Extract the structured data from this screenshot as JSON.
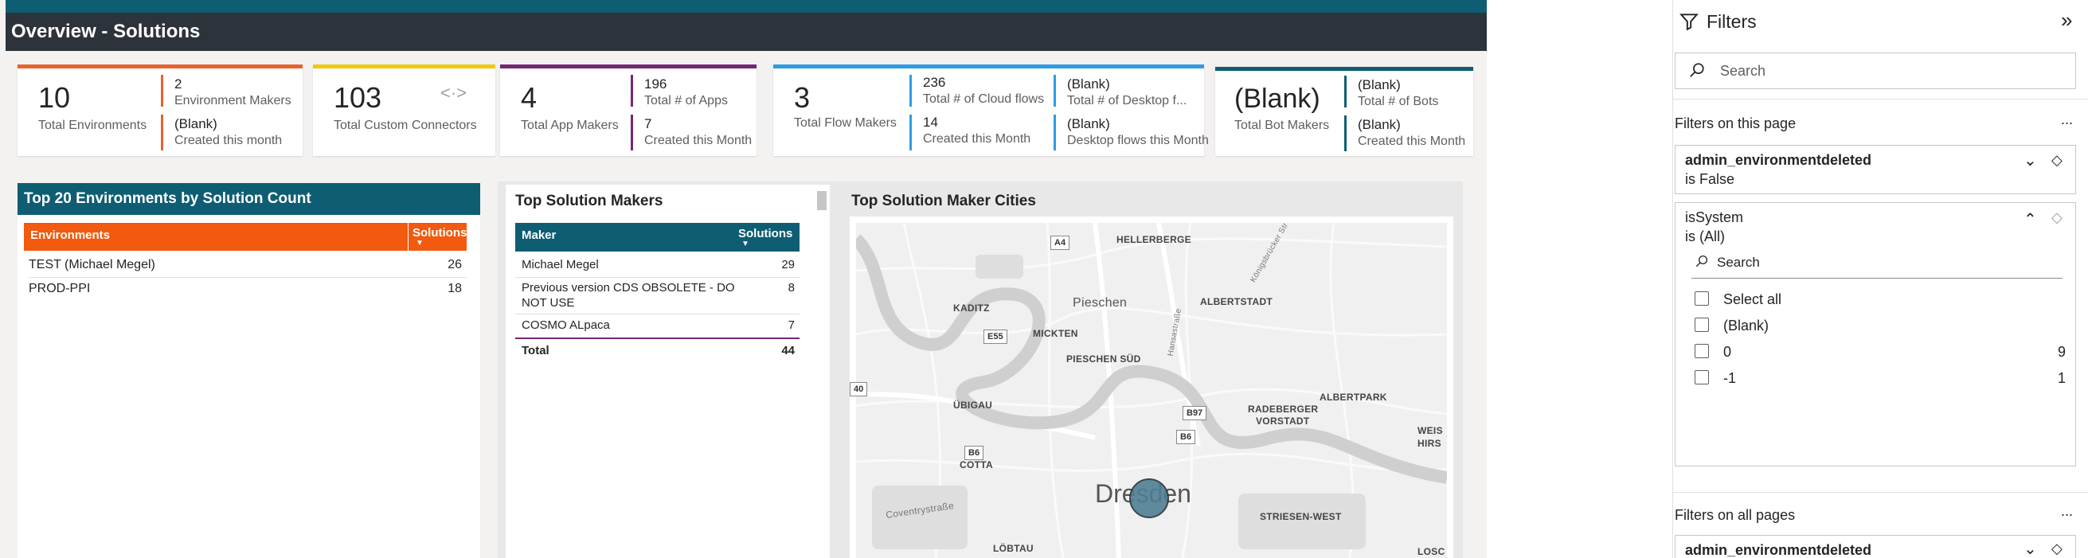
{
  "header": {
    "title": "Overview - Solutions"
  },
  "kpis": {
    "environments": {
      "value": "10",
      "label": "Total Environments",
      "makers_value": "2",
      "makers_label": "Environment Makers",
      "month_value": "(Blank)",
      "month_label": "Created this month",
      "color": "#e8622c"
    },
    "connectors": {
      "value": "103",
      "label": "Total Custom Connectors",
      "color": "#f2c80f"
    },
    "apps": {
      "value": "4",
      "label": "Total App Makers",
      "total_value": "196",
      "total_label": "Total # of Apps",
      "month_value": "7",
      "month_label": "Created this Month",
      "color": "#742774"
    },
    "flows": {
      "value": "3",
      "label": "Total Flow Makers",
      "cloud_value": "236",
      "cloud_label": "Total # of Cloud flows",
      "cloud_month_value": "14",
      "cloud_month_label": "Created this Month",
      "desktop_value": "(Blank)",
      "desktop_label": "Total # of Desktop f...",
      "desktop_month_value": "(Blank)",
      "desktop_month_label": "Desktop flows this Month",
      "color": "#2e9ce6"
    },
    "bots": {
      "value": "(Blank)",
      "label": "Total Bot Makers",
      "total_value": "(Blank)",
      "total_label": "Total # of Bots",
      "month_value": "(Blank)",
      "month_label": "Created this Month",
      "color": "#0e5d73"
    }
  },
  "env_table": {
    "title": "Top 20 Environments by Solution Count",
    "col_env": "Environments",
    "col_sol": "Solutions",
    "rows": [
      {
        "name": "TEST (Michael Megel)",
        "value": "26"
      },
      {
        "name": "PROD-PPI",
        "value": "18"
      }
    ]
  },
  "makers_table": {
    "title": "Top Solution Makers",
    "col_maker": "Maker",
    "col_sol": "Solutions",
    "rows": [
      {
        "name": "Michael Megel",
        "value": "29"
      },
      {
        "name": "Previous version CDS OBSOLETE - DO",
        "name2": "NOT USE",
        "value": "8"
      },
      {
        "name": "COSMO ALpaca",
        "value": "7"
      }
    ],
    "total_label": "Total",
    "total_value": "44"
  },
  "map": {
    "title": "Top Solution Maker Cities",
    "labels": {
      "hellerberge": "HELLERBERGE",
      "kaditz": "KADITZ",
      "pieschen": "Pieschen",
      "albertstadt": "ALBERTSTADT",
      "mickten": "MICKTEN",
      "pieschen_sud": "PIESCHEN SÜD",
      "ubigau": "ÜBIGAU",
      "radeberger": "RADEBERGER",
      "vorstadt": "VORSTADT",
      "albertpark": "ALBERTPARK",
      "cotta": "COTTA",
      "dresden": "Dresden",
      "striesen": "STRIESEN-WEST",
      "lobtau": "LÖBTAU",
      "weis": "WEIS",
      "hirs": "HIRS",
      "losc": "LOSC",
      "coventry": "Coventrystraße",
      "koenigsbrucker": "Königsbrücker Str",
      "hansastr": "Hansastraße"
    },
    "shields": {
      "a4": "A4",
      "e55": "E55",
      "b97": "B97",
      "b6a": "B6",
      "b6b": "B6",
      "b6c": "B6",
      "r40": "40"
    }
  },
  "filters": {
    "title": "Filters",
    "search_placeholder": "Search",
    "on_page_label": "Filters on this page",
    "more": "...",
    "filter1": {
      "name": "admin_environmentdeleted",
      "state": "is False"
    },
    "filter2": {
      "name": "isSystem",
      "state": "is (All)",
      "search": "Search",
      "options": [
        {
          "label": "Select all",
          "count": ""
        },
        {
          "label": "(Blank)",
          "count": ""
        },
        {
          "label": "0",
          "count": "9"
        },
        {
          "label": "-1",
          "count": "1"
        }
      ]
    },
    "all_pages_label": "Filters on all pages",
    "filter3": {
      "name": "admin_environmentdeleted"
    }
  }
}
